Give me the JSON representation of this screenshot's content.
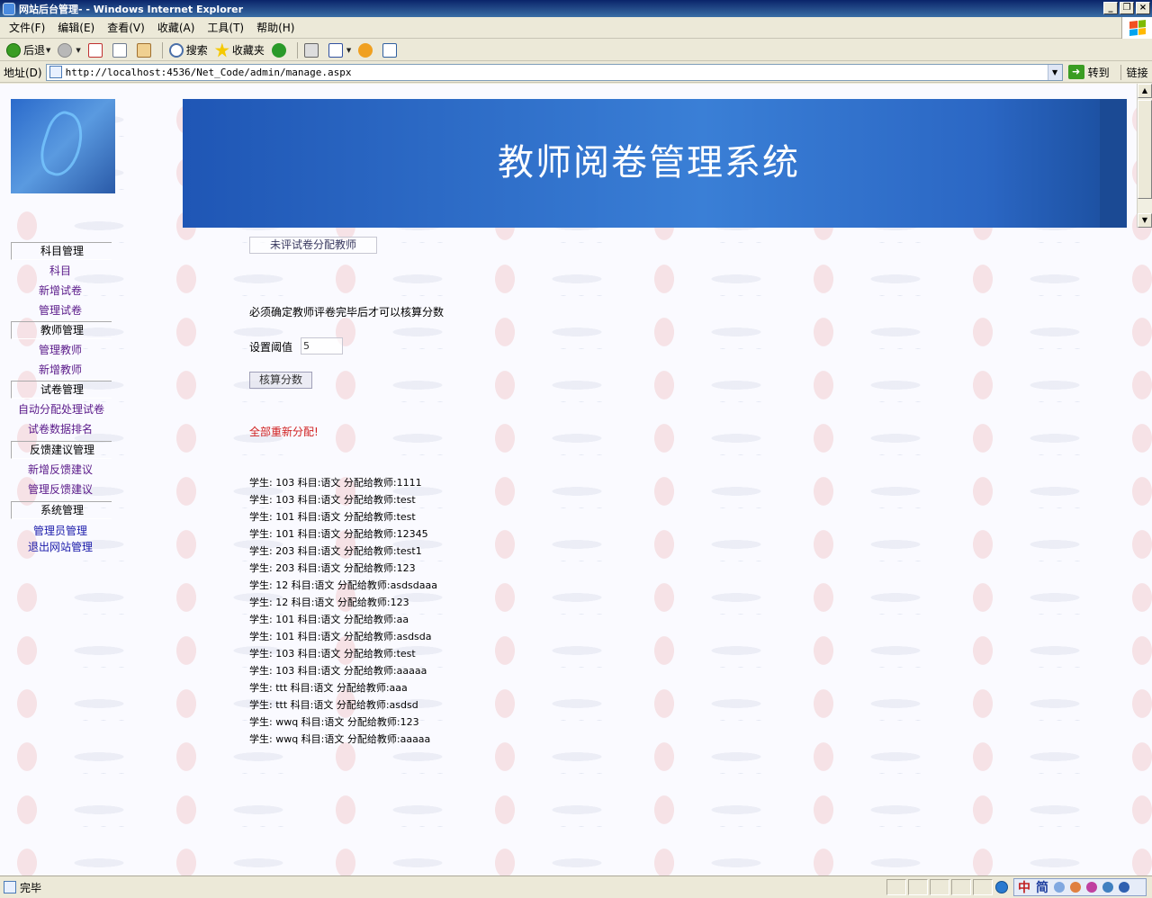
{
  "window": {
    "title": "网站后台管理- - Windows Internet Explorer",
    "controls": {
      "minimize": "_",
      "restore": "❐",
      "close": "×"
    }
  },
  "menu": [
    "文件(F)",
    "编辑(E)",
    "查看(V)",
    "收藏(A)",
    "工具(T)",
    "帮助(H)"
  ],
  "toolbar": {
    "back": "后退",
    "search": "搜索",
    "favorites": "收藏夹"
  },
  "address": {
    "label": "地址(D)",
    "url": "http://localhost:4536/Net_Code/admin/manage.aspx",
    "go": "转到",
    "links": "链接"
  },
  "banner": {
    "title": "教师阅卷管理系统"
  },
  "sidebar": {
    "sections": [
      {
        "label": "科目管理",
        "items": [
          "科目",
          "新增试卷",
          "管理试卷"
        ]
      },
      {
        "label": "教师管理",
        "items": [
          "管理教师",
          "新增教师"
        ]
      },
      {
        "label": "试卷管理",
        "items": [
          "自动分配处理试卷",
          "试卷数据排名"
        ]
      },
      {
        "label": "反馈建议管理",
        "items": [
          "新增反馈建议",
          "管理反馈建议"
        ]
      },
      {
        "label": "系统管理",
        "items": [
          "管理员管理",
          "退出网站管理"
        ]
      }
    ]
  },
  "main": {
    "assign_button": "未评试卷分配教师",
    "note": "必须确定教师评卷完毕后才可以核算分数",
    "threshold_label": "设置阈值",
    "threshold_value": "5",
    "calc_button": "核算分数",
    "reassign_link": "全部重新分配!",
    "records": [
      "学生: 103 科目:语文 分配给教师:1111",
      "学生: 103 科目:语文 分配给教师:test",
      "学生: 101 科目:语文 分配给教师:test",
      "学生: 101 科目:语文 分配给教师:12345",
      "学生: 203 科目:语文 分配给教师:test1",
      "学生: 203 科目:语文 分配给教师:123",
      "学生: 12 科目:语文 分配给教师:asdsdaaa",
      "学生: 12 科目:语文 分配给教师:123",
      "学生: 101 科目:语文 分配给教师:aa",
      "学生: 101 科目:语文 分配给教师:asdsda",
      "学生: 103 科目:语文 分配给教师:test",
      "学生: 103 科目:语文 分配给教师:aaaaa",
      "学生: ttt 科目:语文 分配给教师:aaa",
      "学生: ttt 科目:语文 分配给教师:asdsd",
      "学生: wwq 科目:语文 分配给教师:123",
      "学生: wwq 科目:语文 分配给教师:aaaaa"
    ]
  },
  "status": {
    "text": "完毕",
    "ime_zh": "中",
    "ime_mode": "简"
  }
}
